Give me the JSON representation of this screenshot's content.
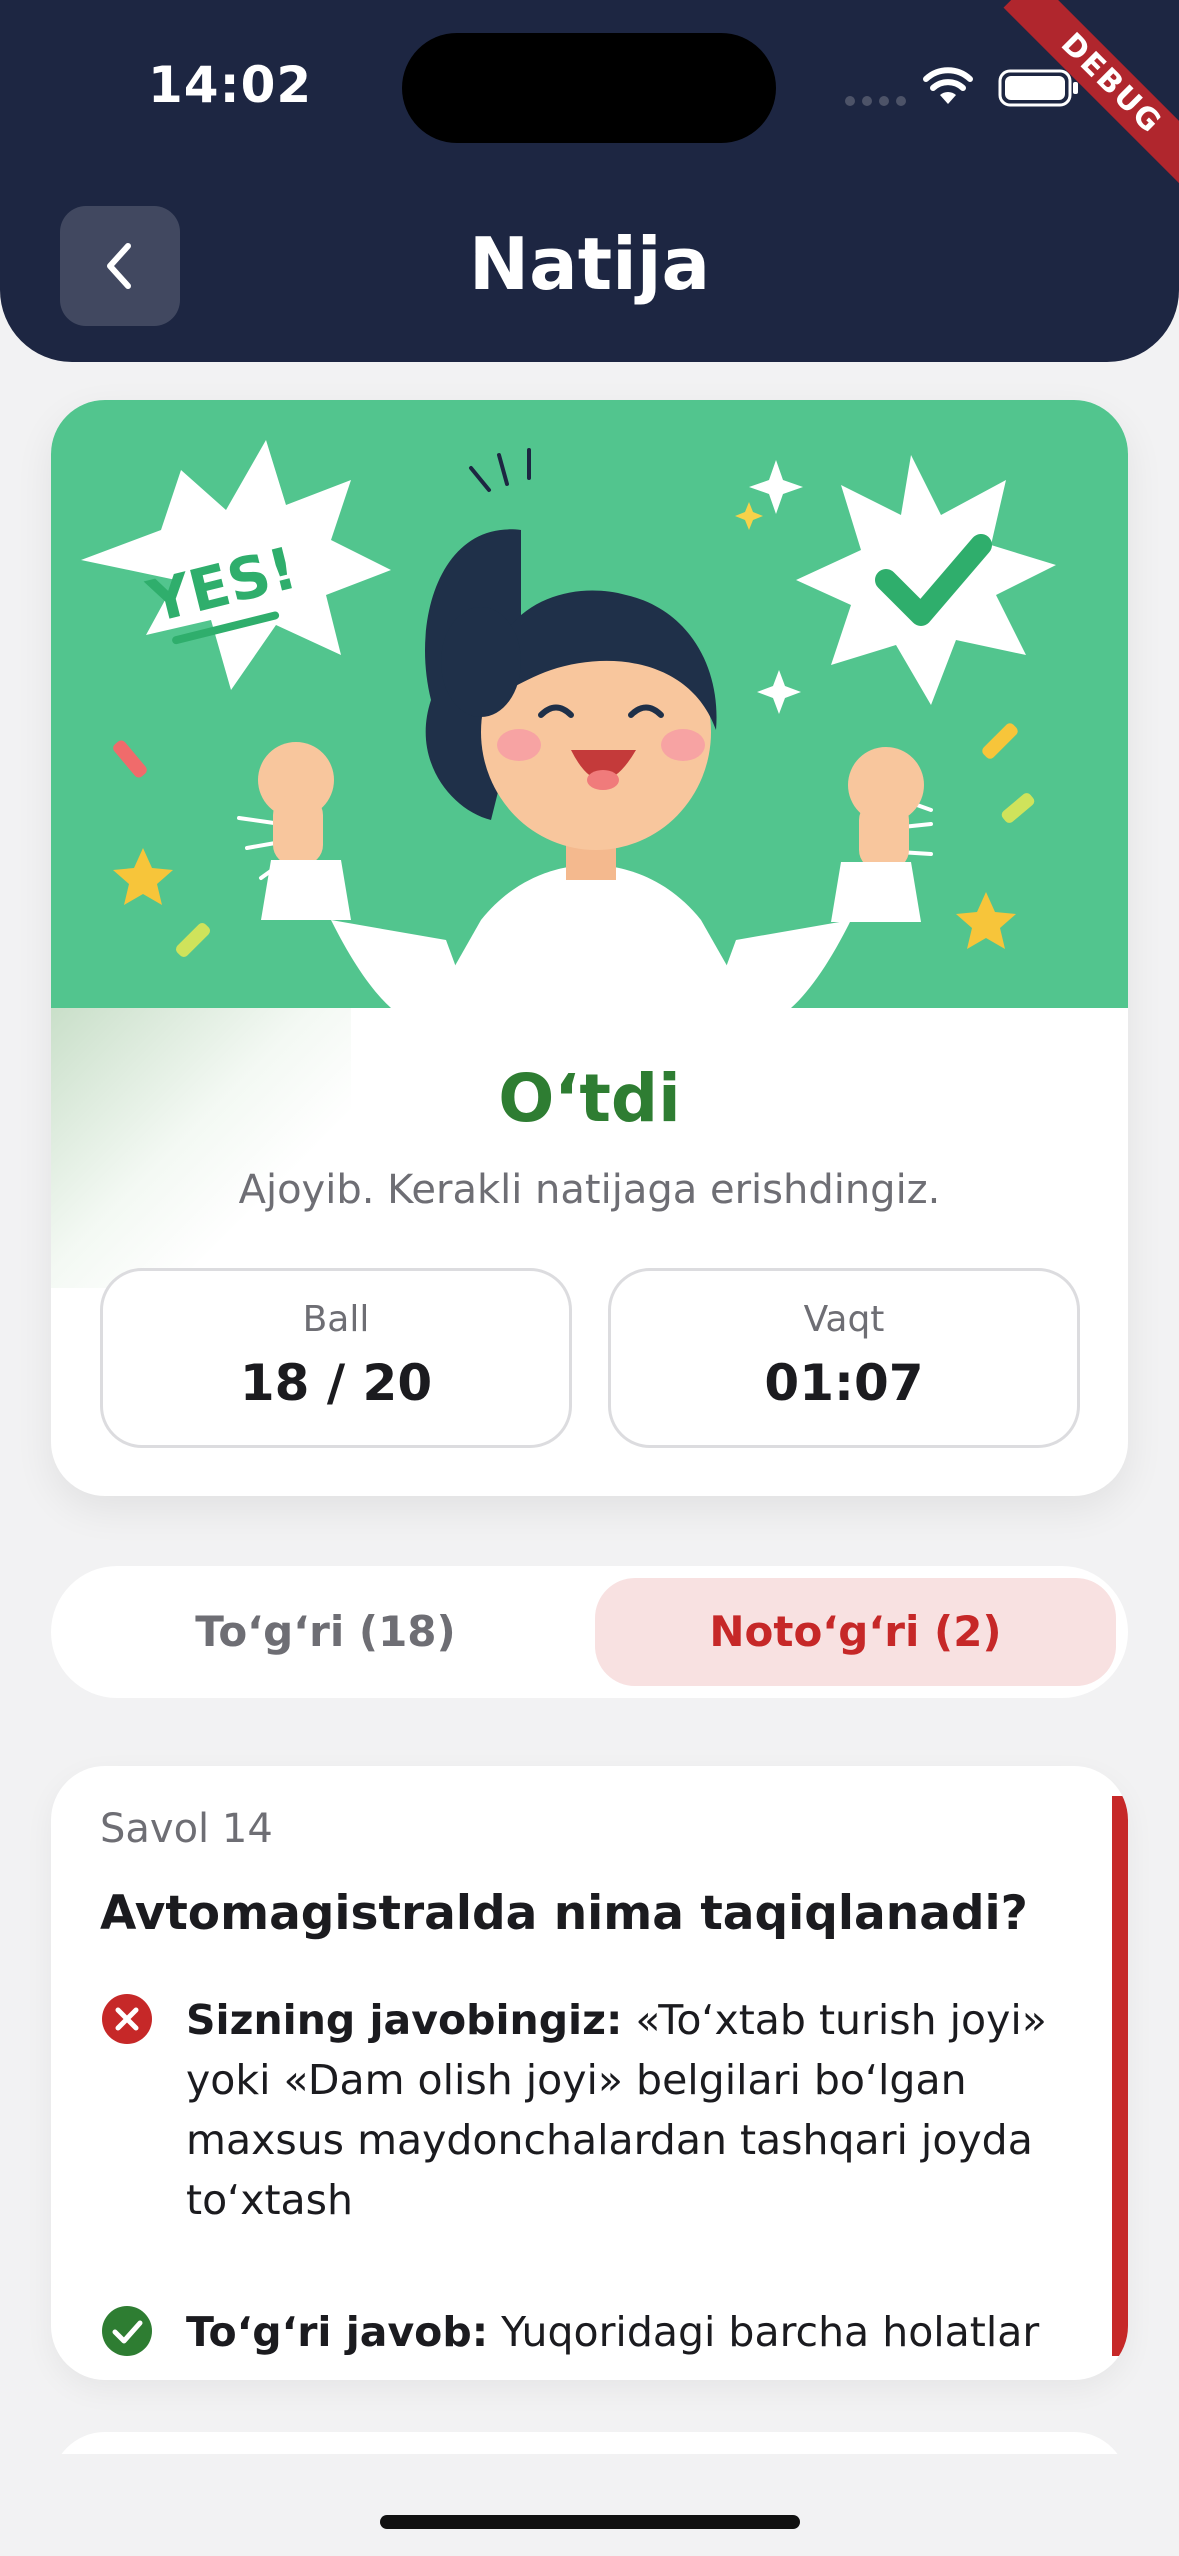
{
  "status_bar": {
    "time": "14:02",
    "debug_label": "DEBUG"
  },
  "header": {
    "title": "Natija"
  },
  "result": {
    "illustration_badges": {
      "left": "YES!"
    },
    "status": "O‘tdi",
    "message": "Ajoyib. Kerakli natijaga erishdingiz.",
    "stats": {
      "score_label": "Ball",
      "score_value": "18 / 20",
      "time_label": "Vaqt",
      "time_value": "01:07"
    }
  },
  "tabs": {
    "correct_label": "To‘g‘ri (18)",
    "wrong_label": "Noto‘g‘ri (2)",
    "selected": "wrong"
  },
  "question": {
    "number": "Savol 14",
    "text": "Avtomagistralda nima taqiqlanadi?",
    "user_answer_label": "Sizning javobingiz:",
    "user_answer_text": " «To‘xtab turish joyi» yoki «Dam olish joyi» belgilari bo‘lgan maxsus maydonchalardan tashqari joyda to‘xtash",
    "correct_answer_label": "To‘g‘ri javob:",
    "correct_answer_text": " Yuqoridagi barcha holatlar"
  },
  "colors": {
    "header_bg": "#1d2642",
    "success": "#2e7d32",
    "error": "#c62828",
    "illustration_bg": "#52c58e"
  },
  "icons": {
    "back": "chevron-left-icon",
    "wrong": "x-circle-icon",
    "right": "check-circle-icon"
  }
}
